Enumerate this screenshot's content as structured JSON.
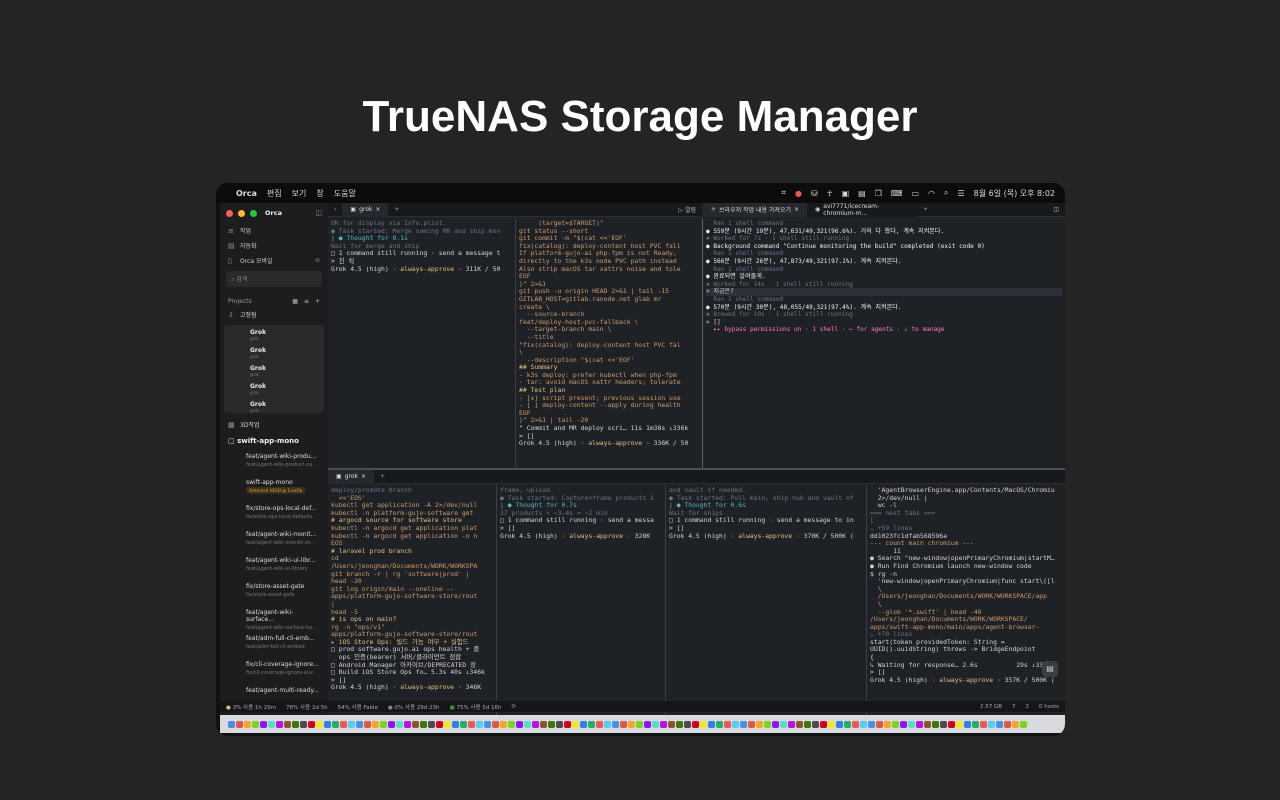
{
  "hero_title": "TrueNAS Storage Manager",
  "menubar": {
    "app": "Orca",
    "items": [
      "편집",
      "보기",
      "창",
      "도움말"
    ],
    "clock": "8월 6일 (목) 오후 8:02"
  },
  "sidebar": {
    "app_name": "Orca",
    "nav": [
      {
        "icon": "≡",
        "label": "작업"
      },
      {
        "icon": "▤",
        "label": "자동화"
      },
      {
        "icon": "▯",
        "label": "Orca 모바일"
      }
    ],
    "search_placeholder": "검색",
    "projects_label": "Projects",
    "pinned_label": "고정됨",
    "pinned_items": [
      {
        "name": "Grok",
        "sub": "grok"
      },
      {
        "name": "Grok",
        "sub": "grok"
      },
      {
        "name": "Grok",
        "sub": "grok"
      },
      {
        "name": "Grok",
        "sub": "grok"
      },
      {
        "name": "Grok",
        "sub": "grok"
      }
    ],
    "section_3d": "3D작업",
    "project_name": "swift-app-mono",
    "worktrees": [
      {
        "title": "feat/agent-wiki-produ...",
        "branch": "feat/agent-wiki-product-ca..."
      },
      {
        "title": "swift-app-mono",
        "branch": "Detached HEAD @ 1cee5b",
        "badge": true
      },
      {
        "title": "fix/store-ops-local-def...",
        "branch": "fix/store-ops-local-defaults"
      },
      {
        "title": "feat/agent-wiki-monit...",
        "branch": "feat/agent-wiki-monitir-sh..."
      },
      {
        "title": "feat/agent-wiki-ui-libr...",
        "branch": "feat/agent-wiki-ui-library"
      },
      {
        "title": "fix/store-asset-gate",
        "branch": "fix/store-asset-gate"
      },
      {
        "title": "feat/agent-wiki-surface...",
        "branch": "feat/agent-wiki-surface-ha..."
      },
      {
        "title": "feat/adm-full-cli-emb...",
        "branch": "feat/adm-full-cli-embed"
      },
      {
        "title": "fix/cli-coverage-ignore...",
        "branch": "fix/cli-coverage-ignore-aux"
      },
      {
        "title": "feat/agent-multi-ready...",
        "branch": ""
      }
    ]
  },
  "top_tabs": {
    "left_tab": "grok",
    "right_tab_1": "브라우저 작업 내용 가져오기",
    "right_tab_2": "avi7771/icecream-chromium-m...",
    "pane_action": "열림"
  },
  "bottom_tabs": {
    "tab": "grok"
  },
  "panes": {
    "top_left": [
      "OK for display via Info.plist.",
      "● Task started: Merge naming MR and ship mon",
      "| ● Thought for 0.1s",
      "",
      "Wait for merge and ship",
      "□ 1 command still running · send a message t",
      "> 진 쉭",
      "Grok 4.5 (high) · always-approve · 311K / 50"
    ],
    "top_middle": [
      "     (target=$TARGET)\"",
      "git status --short",
      "git commit -m \"$(cat <<'EOF'",
      "fix(catalog): deploy-content host PVC fall",
      "",
      "If platform-gujo-ai php-fpm is not Ready,",
      "directly to the k3s node PVC path instead",
      "Also strip macOS tar xattrs noise and tole",
      "EOF",
      ")\" 2>&1",
      "git push -u origin HEAD 2>&1 | tail -15",
      "GITLAB_HOST=gitlab.ranode.net glab mr",
      "create \\",
      "  --source-branch",
      "feat/deploy-host-pvc-fallback \\",
      "  --target-branch main \\",
      "  --title",
      "\"fix(catalog): deploy-content host PVC fal",
      "\\",
      "  --description \"$(cat <<'EOF'",
      "## Summary",
      "- k3s deploy: prefer kubectl when php-fpm",
      "- tar: avoid macOS xattr headers; tolerate",
      "",
      "## Test plan",
      "- [x] script present; previous session use",
      "- [ ] deploy-content --apply during health",
      "EOF",
      ")\" 2>&1 | tail -20",
      "\" Commit and MR deploy scri… 11s 1m38s ↓336k",
      "> []",
      "Grok 4.5 (high) · always-approve · 336K / 50"
    ],
    "top_right": [
      "",
      "  Ran 1 shell command",
      "",
      "● 559분 (9시간 19분), 47,631/49,321(96.6%). 거의 다 왔다, 계속 지켜본다.",
      "",
      "✱ Worked for 7s · 1 shell still running",
      "",
      "● Background command \"Continue monitoring the build\" completed (exit code 0)",
      "",
      "  Ran 1 shell command",
      "",
      "● 566분 (9시간 26분), 47,873/49,321(97.1%). 계속 지켜본다.",
      "",
      "  Ran 1 shell command",
      "",
      "● 완료되면 알려줄게.",
      "",
      "✱ Worked for 14s · 1 shell still running",
      "",
      "> 지금은?",
      "",
      "  Ran 1 shell command",
      "",
      "● 570분 (9시간 30분), 48,055/49,321(97.4%). 계속 지켜본다.",
      "",
      "✱ Brewed for 10s · 1 shell still running",
      "",
      "> []",
      "",
      "  ▸▸ bypass permissions on · 1 shell · ← for agents · ↓ to manage"
    ],
    "bottom_1": [
      "deploy/promote branch",
      "  <<'EOS'",
      "kubectl get application -A 2>/dev/null",
      "kubectl -n platform-gujo-software get",
      "# argocd source for software store",
      "kubectl -n argocd get application plat",
      "kubectl -n argocd get application -o n",
      "EOS",
      "",
      "# laravel prod branch",
      "cd",
      "/Users/jeonghan/Documents/WORK/WORKSPA",
      "git branch -r | rg 'software|prod' |",
      "head -20",
      "git log origin/main --oneline --",
      "apps/platform-gujo-software-store/rout",
      "|",
      "head -5",
      "# is ops on main?",
      "rg -n \"ops/v1\"",
      "apps/platform-gujo-software-store/rout",
      "▸ iOS Store Ops: 빌드 가능 여부 + 실험드",
      "□ prod software.gujo.ai ops health + 플",
      "  ops 인증(bearer) 서버/클라이언트 점합",
      "□ Android Manager 아카이브/DEPRECATED 정",
      "□ Build iOS Store Ops fo… 5.3s 40s ↓346k",
      "> []",
      "Grok 4.5 (high) · always-approve · 346K"
    ],
    "bottom_2": [
      "frame, upload.",
      "● Task started: Capture+frame products 1",
      "| ● Thought for 0.7s",
      "",
      "37 products × ~3–4s ≈ ~2 min",
      "□ 1 command still running · send a messa",
      "> []",
      "Grok 4.5 (high) · always-approve · 328K"
    ],
    "bottom_3": [
      "and vault if needed.",
      "● Task started: Pull main; ship hub and vault of",
      "| ● Thought for 0.6s",
      "",
      "Wait for ships",
      "□ 1 command still running · send a message to in",
      "> []",
      "Grok 4.5 (high) · always-approve · 370K / 500K ("
    ],
    "bottom_4": [
      "  'AgentBrowserEngine.app/Contents/MacOS/Chromiu",
      "  2>/dev/null |",
      "  wc -l",
      "",
      "=== nest tabs ===",
      "[",
      "… +59 lines",
      "dd1023fc1dfab568596a",
      "--- count main chromium ---",
      "      11",
      "● Search \"new-window|openPrimaryChromium|startM…",
      "● Run Find Chromium launch new-window code",
      "$ rg -n",
      "  'new-window|openPrimaryChromium|func start\\([l",
      "  \\",
      "  /Users/jeonghan/Documents/WORK/WORKSPACE/app",
      "  \\",
      "  --glob '*.swift' | head -40",
      "",
      "/Users/jeonghan/Documents/WORK/WORKSPACE/",
      "apps/swift-app-mono/main/apps/agent-browser-",
      "… +70 lines",
      "start(token providedToken: String =",
      "UUID().uuidString) throws -> BridgeEndpoint",
      "{",
      "↳ Waiting for response… 2.6s          29s ↓337k",
      "> []",
      "Grok 4.5 (high) · always-approve · 357K / 500K ("
    ]
  },
  "statusbar": {
    "items": [
      "3% 사용 1h 29m",
      "78% 사용 2d 5h",
      "54% 사용 Fable",
      "0% 사용 29d 23h",
      "75% 사용 5d 16h"
    ],
    "right": [
      "2.57 GB",
      "7",
      "2",
      "0 hosts"
    ]
  },
  "colors": {
    "accent": "#61afef",
    "mode": "#ff79c6"
  }
}
